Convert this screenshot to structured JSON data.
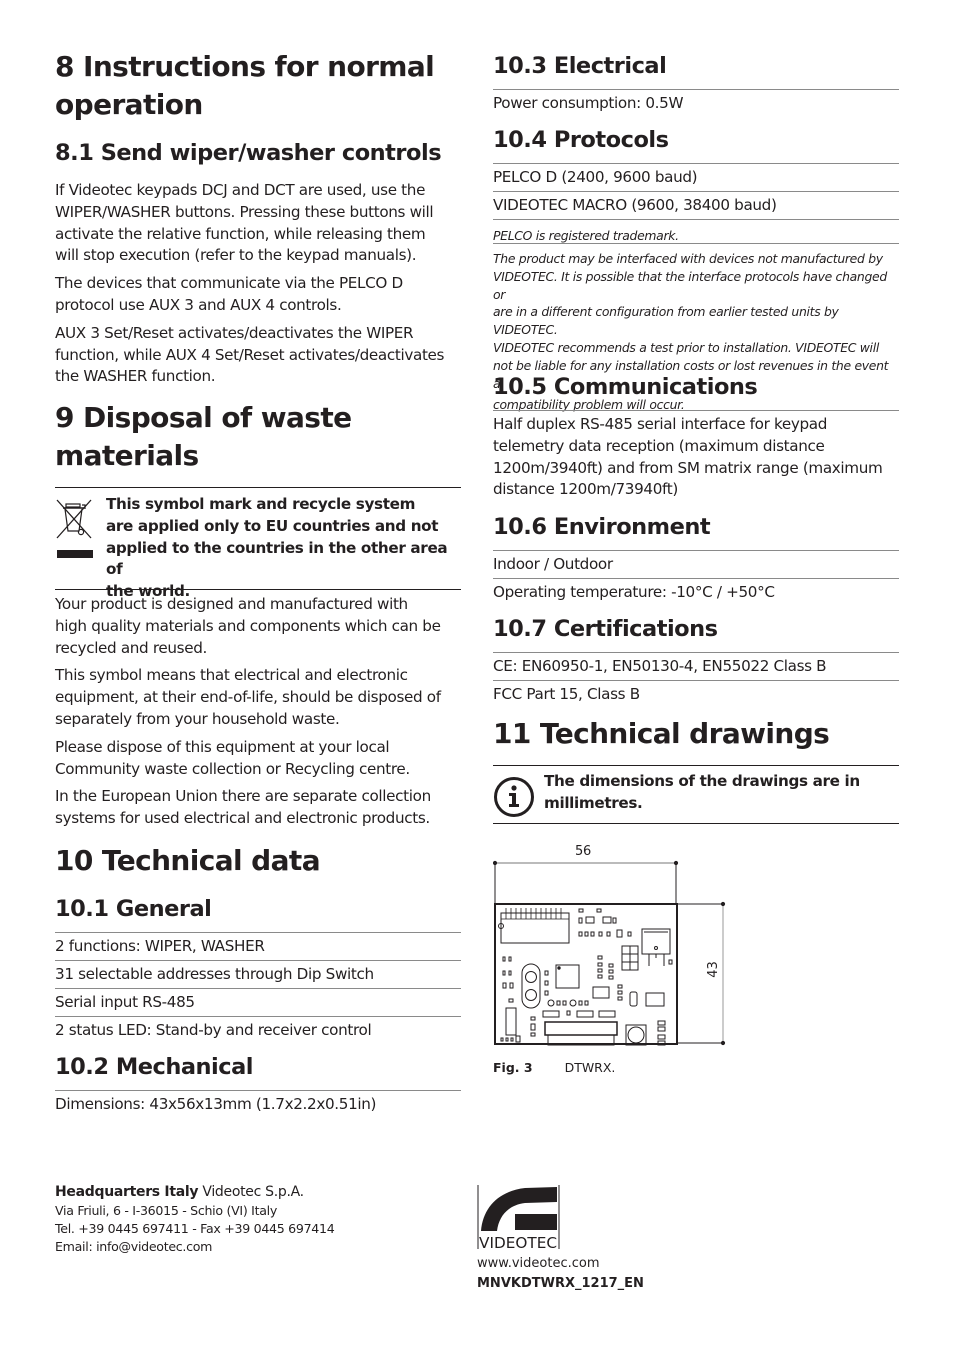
{
  "left": {
    "sec8": {
      "title_line1": "8 Instructions for normal",
      "title_line2": "operation"
    },
    "sec8_1": {
      "title": "8.1 Send wiper/washer controls",
      "paragraphs": [
        [
          "If Videotec keypads DCJ and DCT  are used, use the",
          "WIPER/WASHER buttons. Pressing these buttons will",
          "activate the relative function, while releasing them",
          "will stop execution (refer to the keypad manuals)."
        ],
        [
          "The devices that communicate via the PELCO D",
          "protocol use AUX 3 and AUX 4 controls."
        ],
        [
          "AUX 3 Set/Reset activates/deactivates the WIPER",
          "function, while AUX 4 Set/Reset activates/deactivates",
          "the WASHER function."
        ]
      ]
    },
    "sec9": {
      "title_line1": "9 Disposal of waste",
      "title_line2": "materials",
      "note": [
        "This symbol mark and recycle system",
        "are applied only to EU countries and not",
        "applied to the countries in the other area of",
        "the world."
      ],
      "note_icon": "weee-crossed-bin-icon",
      "paragraphs": [
        [
          "Your product is designed and manufactured with",
          "high quality materials and components which can be",
          "recycled and reused."
        ],
        [
          "This symbol means that electrical and electronic",
          "equipment, at their end-of-life, should be disposed of",
          "separately from your household waste."
        ],
        [
          "Please dispose of this equipment at your local",
          "Community waste collection or Recycling centre."
        ],
        [
          "In the European Union there are separate collection",
          "systems for used electrical and electronic products."
        ]
      ]
    },
    "sec10": {
      "title": "10 Technical data"
    },
    "sec10_1": {
      "title": "10.1 General",
      "rows": [
        "2 functions: WIPER, WASHER",
        "31 selectable addresses through Dip Switch",
        "Serial input RS-485",
        "2 status LED: Stand-by and receiver control"
      ]
    },
    "sec10_2": {
      "title": "10.2 Mechanical",
      "rows": [
        "Dimensions: 43x56x13mm (1.7x2.2x0.51in)"
      ]
    }
  },
  "right": {
    "sec10_3": {
      "title": "10.3 Electrical",
      "rows": [
        "Power consumption: 0.5W"
      ]
    },
    "sec10_4": {
      "title": "10.4 Protocols",
      "rows": [
        "PELCO D (2400, 9600 baud)",
        "VIDEOTEC MACRO (9600, 38400 baud)"
      ],
      "trademark": "PELCO is registered trademark.",
      "disclaimer": [
        "The product may be interfaced with devices not manufactured by",
        "VIDEOTEC. It is possible that the interface protocols have changed or",
        "are in a different configuration from earlier tested units by VIDEOTEC.",
        "VIDEOTEC recommends a test prior to installation. VIDEOTEC will",
        "not be liable for any installation costs or lost revenues in the event a",
        "compatibility problem will occur."
      ]
    },
    "sec10_5": {
      "title": "10.5 Communications",
      "lines": [
        "Half duplex RS-485 serial interface for keypad",
        "telemetry data reception (maximum distance",
        "1200m/3940ft) and from SM matrix range (maximum",
        "distance 1200m/73940ft)"
      ]
    },
    "sec10_6": {
      "title": "10.6 Environment",
      "rows": [
        "Indoor / Outdoor",
        "Operating temperature: -10°C / +50°C"
      ]
    },
    "sec10_7": {
      "title": "10.7 Certifications",
      "rows": [
        "CE: EN60950-1, EN50130-4, EN55022 Class B",
        "FCC Part 15, Class B"
      ]
    },
    "sec11": {
      "title": "11 Technical drawings",
      "note": [
        "The dimensions of the drawings are in",
        "millimetres."
      ],
      "note_icon": "info-icon",
      "drawing": {
        "width_label": "56",
        "height_label": "43"
      },
      "figure_number": "Fig. 3",
      "figure_caption": "DTWRX."
    }
  },
  "footer": {
    "hq_bold": "Headquarters Italy",
    "hq_company": " Videotec S.p.A.",
    "address": "Via Friuli, 6 - I-36015 - Schio (VI) Italy",
    "phone": "Tel. +39 0445 697411 - Fax +39 0445 697414",
    "email": "Email: info@videotec.com",
    "logo_text": "VIDEOTEC",
    "website": "www.videotec.com",
    "doc_code": "MNVKDTWRX_1217_EN"
  }
}
